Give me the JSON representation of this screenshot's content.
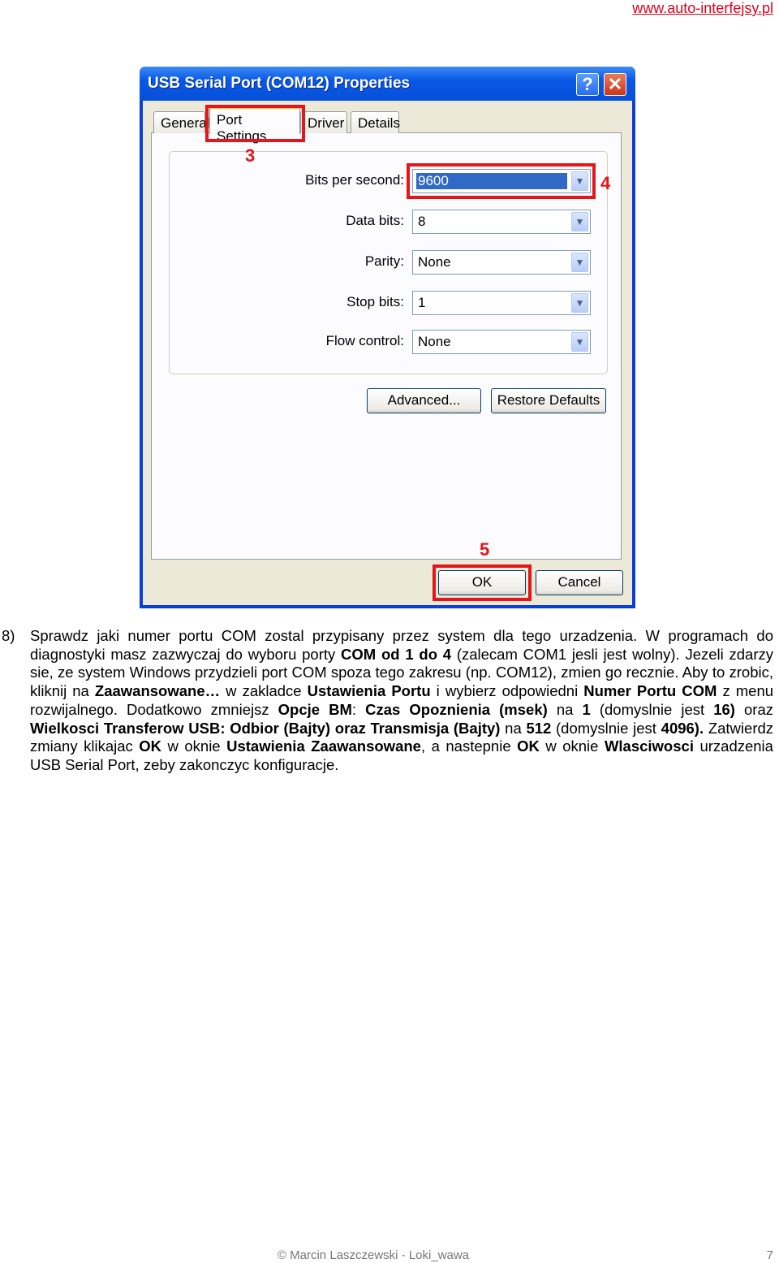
{
  "header": {
    "link": "www.auto-interfejsy.pl"
  },
  "dialog": {
    "title": "USB Serial Port (COM12) Properties",
    "help_icon": "?",
    "close_icon": "✕",
    "tabs": [
      "General",
      "Port Settings",
      "Driver",
      "Details"
    ],
    "active_tab": "Port Settings",
    "fields": [
      {
        "label": "Bits per second:",
        "value": "9600"
      },
      {
        "label": "Data bits:",
        "value": "8"
      },
      {
        "label": "Parity:",
        "value": "None"
      },
      {
        "label": "Stop bits:",
        "value": "1"
      },
      {
        "label": "Flow control:",
        "value": "None"
      }
    ],
    "advanced_button": "Advanced...",
    "restore_button": "Restore Defaults",
    "ok_button": "OK",
    "cancel_button": "Cancel",
    "annotations": [
      "3",
      "4",
      "5"
    ],
    "highlight_color": "#e4161c"
  },
  "step": {
    "number": "8)",
    "segments": [
      {
        "t": "Sprawdz jaki numer portu COM zostal przypisany przez system dla tego urzadzenia. W programach do diagnostyki masz zazwyczaj do wyboru porty ",
        "b": false
      },
      {
        "t": "COM od 1 do 4",
        "b": true
      },
      {
        "t": " (zalecam COM1 jesli jest wolny). Jezeli zdarzy sie, ze system Windows przydzieli port COM spoza tego zakresu (np. COM12), zmien go recznie. Aby to zrobic, kliknij na ",
        "b": false
      },
      {
        "t": "Zaawansowane…",
        "b": true
      },
      {
        "t": " w zakladce ",
        "b": false
      },
      {
        "t": "Ustawienia Portu",
        "b": true
      },
      {
        "t": " i wybierz odpowiedni ",
        "b": false
      },
      {
        "t": "Numer Portu COM",
        "b": true
      },
      {
        "t": " z menu rozwijalnego. Dodatkowo zmniejsz ",
        "b": false
      },
      {
        "t": "Opcje BM",
        "b": true
      },
      {
        "t": ": ",
        "b": false
      },
      {
        "t": "Czas Opoznienia (msek)",
        "b": true
      },
      {
        "t": " na ",
        "b": false
      },
      {
        "t": "1",
        "b": true
      },
      {
        "t": " (domyslnie jest ",
        "b": false
      },
      {
        "t": "16)",
        "b": true
      },
      {
        "t": " oraz ",
        "b": false
      },
      {
        "t": "Wielkosci Transferow USB: Odbior (Bajty) oraz Transmisja (Bajty)",
        "b": true
      },
      {
        "t": " na ",
        "b": false
      },
      {
        "t": "512",
        "b": true
      },
      {
        "t": " (domyslnie jest ",
        "b": false
      },
      {
        "t": "4096).",
        "b": true
      },
      {
        "t": " Zatwierdz zmiany klikajac ",
        "b": false
      },
      {
        "t": "OK",
        "b": true
      },
      {
        "t": " w oknie ",
        "b": false
      },
      {
        "t": "Ustawienia Zaawansowane",
        "b": true
      },
      {
        "t": ", a nastepnie ",
        "b": false
      },
      {
        "t": "OK",
        "b": true
      },
      {
        "t": " w oknie ",
        "b": false
      },
      {
        "t": "Wlasciwosci",
        "b": true
      },
      {
        "t": " urzadzenia USB Serial Port, zeby zakonczyc konfiguracje.",
        "b": false
      }
    ]
  },
  "footer": {
    "text": "© Marcin Laszczewski - Loki_wawa",
    "page": "7"
  }
}
